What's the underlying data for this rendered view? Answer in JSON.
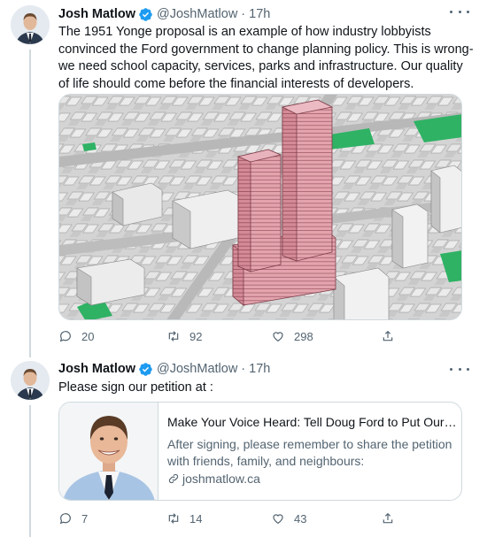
{
  "colors": {
    "verified": "#1d9bf0",
    "secondary": "#536471",
    "border": "#cfd9de"
  },
  "tweets": [
    {
      "name": "Josh Matlow",
      "handle": "@JoshMatlow",
      "time": "17h",
      "text": "The 1951 Yonge proposal is an example of how industry lobbyists convinced the Ford government to change planning policy. This is wrong- we need school capacity, services, parks and infrastructure. Our quality of life should come before the financial interests of developers.",
      "media_icon": "3d-building-render",
      "replies": "20",
      "retweets": "92",
      "likes": "298"
    },
    {
      "name": "Josh Matlow",
      "handle": "@JoshMatlow",
      "time": "17h",
      "text": "Please sign our petition at :",
      "card": {
        "title": "Make Your Voice Heard: Tell Doug Ford to Put Our Co...",
        "description": "After signing, please remember to share the petition with friends, family, and neighbours:",
        "domain": "joshmatlow.ca"
      },
      "replies": "7",
      "retweets": "14",
      "likes": "43"
    }
  ]
}
